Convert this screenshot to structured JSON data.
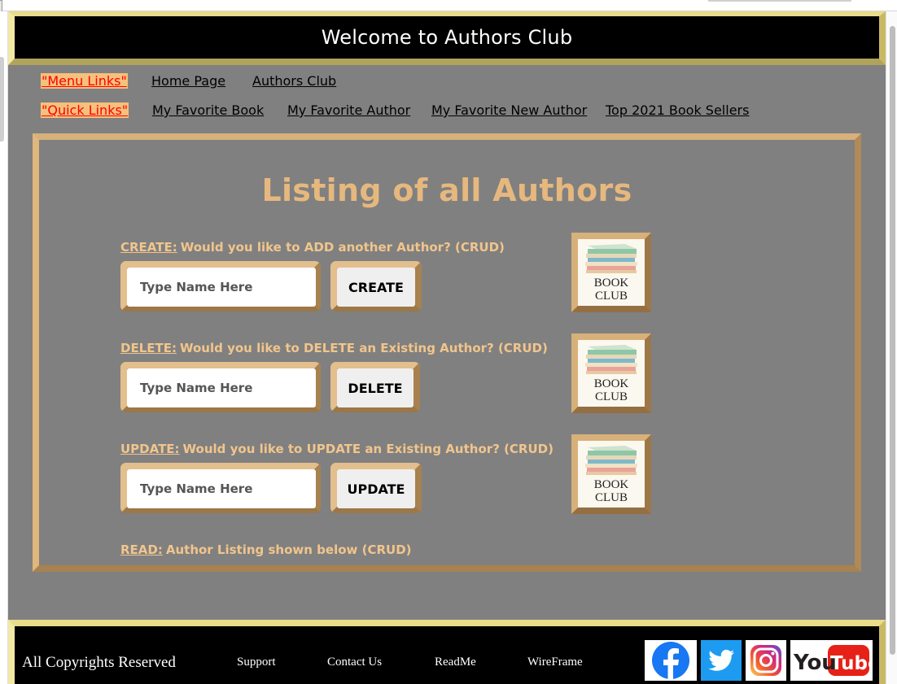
{
  "header": {
    "title": "Welcome to Authors Club"
  },
  "nav": {
    "menu_label": "\"Menu Links\"",
    "menu_links": [
      "Home Page",
      "Authors Club"
    ],
    "quick_label": "\"Quick Links\"",
    "quick_links": [
      "My Favorite Book",
      "My Favorite Author",
      "My Favorite New Author",
      "Top 2021 Book Sellers"
    ]
  },
  "main": {
    "title": "Listing of all Authors",
    "create": {
      "key": "CREATE:",
      "text": "Would you like to ADD another Author? (CRUD)",
      "placeholder": "Type Name Here",
      "value": "",
      "button": "CREATE"
    },
    "delete": {
      "key": "DELETE:",
      "text": "Would you like to DELETE an Existing Author? (CRUD)",
      "placeholder": "Type Name Here",
      "value": "",
      "button": "DELETE"
    },
    "update": {
      "key": "UPDATE:",
      "text": "Would you like to UPDATE an Existing Author? (CRUD)",
      "placeholder": "Type Name Here",
      "value": "",
      "button": "UPDATE"
    },
    "read": {
      "key": "READ:",
      "text": "Author Listing shown below (CRUD)"
    },
    "book_club_image": {
      "line1": "BOOK",
      "line2": "CLUB"
    }
  },
  "footer": {
    "copyright": "All Copyrights Reserved",
    "links": [
      "Support",
      "Contact Us",
      "ReadMe",
      "WireFrame"
    ],
    "social": {
      "facebook_icon": "facebook-icon",
      "twitter_icon": "twitter-icon",
      "instagram_icon": "instagram-icon",
      "youtube_icon": "youtube-icon",
      "youtube_text_1": "You",
      "youtube_text_2": "Tube"
    }
  },
  "colors": {
    "header_border": "#e9dc8a",
    "panel_border": "#d4a867",
    "accent_text": "#e6b87e",
    "page_bg": "#808080",
    "nav_label_red": "#ff0000",
    "nav_label_bg": "#f6c17c"
  }
}
